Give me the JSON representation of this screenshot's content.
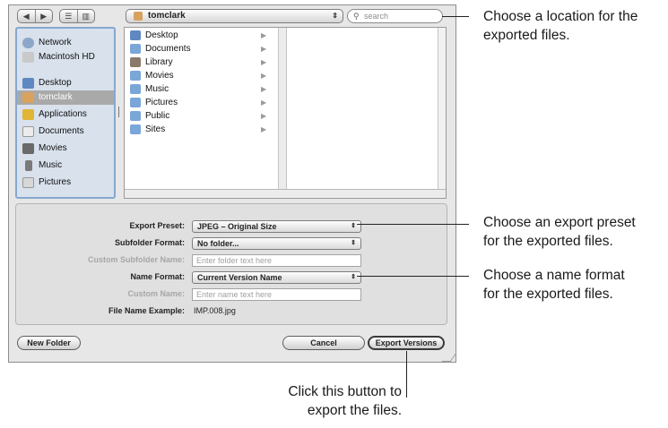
{
  "toolbar": {
    "nav_back": "◀",
    "nav_forward": "▶",
    "view_list": "☰",
    "view_columns": "▥",
    "location": "tomclark",
    "location_icon": "home-icon",
    "search_placeholder": "search"
  },
  "sidebar": {
    "items": [
      {
        "label": "Network",
        "icon": "network-icon",
        "color": "#8da7c8"
      },
      {
        "label": "Macintosh HD",
        "icon": "hard-drive-icon",
        "color": "#c9c9c9"
      },
      {
        "label": "Desktop",
        "icon": "desktop-icon",
        "color": "#5f88c2"
      },
      {
        "label": "tomclark",
        "icon": "home-icon",
        "color": "#d9a25c"
      },
      {
        "label": "Applications",
        "icon": "applications-icon",
        "color": "#e0b536"
      },
      {
        "label": "Documents",
        "icon": "documents-icon",
        "color": "#ececec"
      },
      {
        "label": "Movies",
        "icon": "movies-icon",
        "color": "#6a6a6a"
      },
      {
        "label": "Music",
        "icon": "music-icon",
        "color": "#7a7a7a"
      },
      {
        "label": "Pictures",
        "icon": "pictures-icon",
        "color": "#d7d7d7"
      }
    ]
  },
  "browser": {
    "items": [
      {
        "label": "Desktop",
        "icon": "desktop-folder-icon"
      },
      {
        "label": "Documents",
        "icon": "documents-folder-icon"
      },
      {
        "label": "Library",
        "icon": "library-folder-icon"
      },
      {
        "label": "Movies",
        "icon": "movies-folder-icon"
      },
      {
        "label": "Music",
        "icon": "music-folder-icon"
      },
      {
        "label": "Pictures",
        "icon": "pictures-folder-icon"
      },
      {
        "label": "Public",
        "icon": "public-folder-icon"
      },
      {
        "label": "Sites",
        "icon": "sites-folder-icon"
      }
    ]
  },
  "options": {
    "export_preset_label": "Export Preset:",
    "export_preset_value": "JPEG – Original Size",
    "subfolder_format_label": "Subfolder Format:",
    "subfolder_format_value": "No folder...",
    "custom_subfolder_label": "Custom Subfolder Name:",
    "custom_subfolder_placeholder": "Enter folder text here",
    "name_format_label": "Name Format:",
    "name_format_value": "Current Version Name",
    "custom_name_label": "Custom Name:",
    "custom_name_placeholder": "Enter name text here",
    "file_name_example_label": "File Name Example:",
    "file_name_example_value": "IMP.008.jpg"
  },
  "buttons": {
    "new_folder": "New Folder",
    "cancel": "Cancel",
    "export_versions": "Export Versions"
  },
  "annotations": {
    "location_line1": "Choose a location for the",
    "location_line2": "exported files.",
    "preset_line1": "Choose an export preset",
    "preset_line2": "for the exported files.",
    "name_line1": "Choose a name format",
    "name_line2": "for the exported files.",
    "button_line1": "Click this button to",
    "button_line2": "export the files."
  }
}
